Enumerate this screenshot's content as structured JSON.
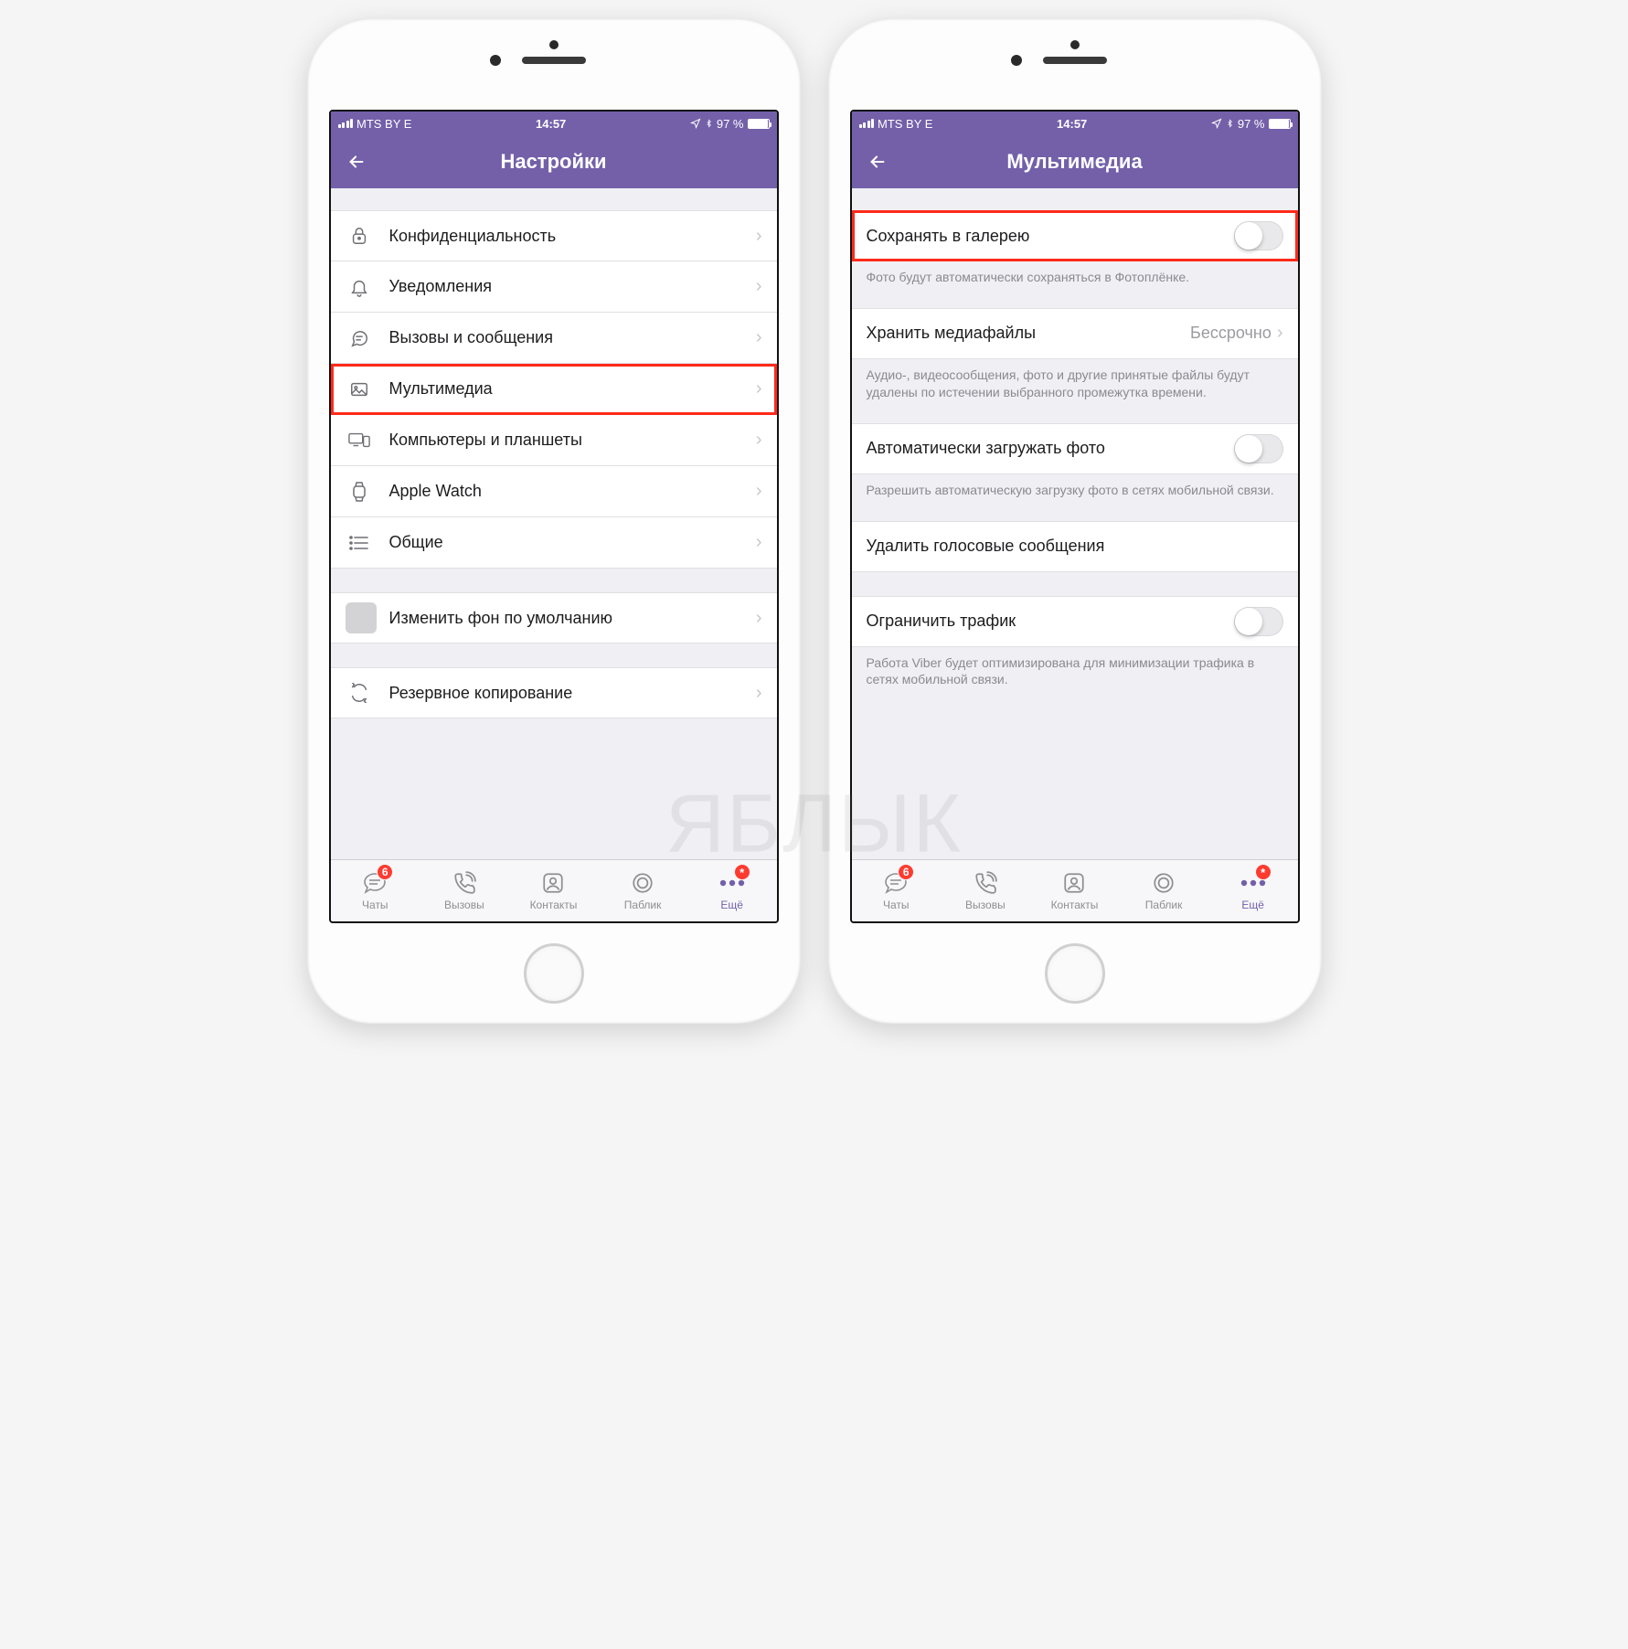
{
  "status": {
    "carrier": "MTS BY  E",
    "time": "14:57",
    "battery_pct": "97 %"
  },
  "left": {
    "title": "Настройки",
    "rows": [
      {
        "label": "Конфиденциальность"
      },
      {
        "label": "Уведомления"
      },
      {
        "label": "Вызовы и сообщения"
      },
      {
        "label": "Мультимедиа"
      },
      {
        "label": "Компьютеры и планшеты"
      },
      {
        "label": "Apple Watch"
      },
      {
        "label": "Общие"
      }
    ],
    "change_bg": "Изменить фон по умолчанию",
    "backup": "Резервное копирование"
  },
  "right": {
    "title": "Мультимедиа",
    "save_gallery": "Сохранять в галерею",
    "save_gallery_note": "Фото будут автоматически сохраняться в Фотоплёнке.",
    "store_media": "Хранить медиафайлы",
    "store_media_value": "Бессрочно",
    "store_media_note": "Аудио-, видеосообщения, фото и другие принятые файлы будут удалены по истечении выбранного промежутка времени.",
    "auto_download": "Автоматически загружать фото",
    "auto_download_note": "Разрешить автоматическую загрузку фото в сетях мобильной связи.",
    "delete_voice": "Удалить голосовые сообщения",
    "limit_traffic": "Ограничить трафик",
    "limit_traffic_note": "Работа Viber будет оптимизирована для минимизации трафика в сетях мобильной связи."
  },
  "tabs": {
    "chats": "Чаты",
    "calls": "Вызовы",
    "contacts": "Контакты",
    "public": "Паблик",
    "more": "Ещё",
    "chats_badge": "6",
    "more_badge": "*"
  },
  "watermark": "ЯБЛЫК"
}
